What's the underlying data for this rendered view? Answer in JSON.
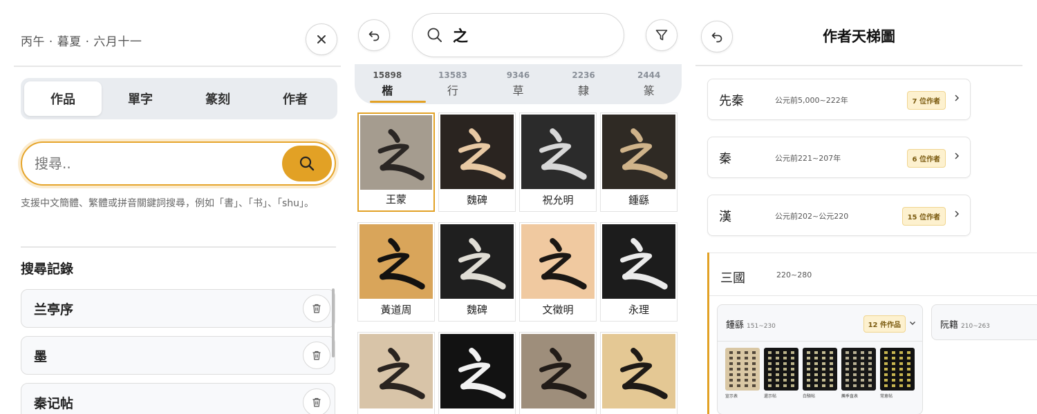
{
  "home": {
    "date": "丙午 · 暮夏 · 六月十一",
    "tabs": [
      "作品",
      "單字",
      "篆刻",
      "作者"
    ],
    "active_tab": 0,
    "search_placeholder": "搜尋..",
    "hint": "支援中文簡體、繁體或拼音關鍵詞搜尋，例如「書」、「书」、「shu」。",
    "history_title": "搜尋記錄",
    "history": [
      "兰亭序",
      "墨",
      "秦记帖"
    ]
  },
  "results": {
    "query": "之",
    "scripts": [
      {
        "count": "15898",
        "name": "楷"
      },
      {
        "count": "13583",
        "name": "行"
      },
      {
        "count": "9346",
        "name": "草"
      },
      {
        "count": "2236",
        "name": "隸"
      },
      {
        "count": "2444",
        "name": "篆"
      }
    ],
    "active_script": 0,
    "items": [
      {
        "label": "王蒙",
        "bg": "#a59c8f",
        "ink": "#2a2624"
      },
      {
        "label": "魏碑",
        "bg": "#2a2420",
        "ink": "#e8c9a4"
      },
      {
        "label": "祝允明",
        "bg": "#2b2b2b",
        "ink": "#d8d8d8"
      },
      {
        "label": "鍾繇",
        "bg": "#2f2a24",
        "ink": "#cfb38a"
      },
      {
        "label": "黃道周",
        "bg": "#d9a55a",
        "ink": "#141210"
      },
      {
        "label": "魏碑",
        "bg": "#1f1f1f",
        "ink": "#e0ddd5"
      },
      {
        "label": "文徵明",
        "bg": "#f0c9a0",
        "ink": "#1b1714"
      },
      {
        "label": "永理",
        "bg": "#1c1c1c",
        "ink": "#ebebeb"
      },
      {
        "label": "",
        "bg": "#d8c4a8",
        "ink": "#2a2420"
      },
      {
        "label": "",
        "bg": "#121212",
        "ink": "#f2f2f2"
      },
      {
        "label": "",
        "bg": "#9e8e7b",
        "ink": "#221c18"
      },
      {
        "label": "",
        "bg": "#e4c894",
        "ink": "#1e1a16"
      }
    ]
  },
  "ladder": {
    "title": "作者天梯圖",
    "eras": [
      {
        "name": "先秦",
        "range": "公元前5,000~222年",
        "badge": "7 位作者"
      },
      {
        "name": "秦",
        "range": "公元前221~207年",
        "badge": "6 位作者"
      },
      {
        "name": "漢",
        "range": "公元前202~公元220",
        "badge": "15 位作者"
      }
    ],
    "open_era": {
      "name": "三國",
      "range": "220~280",
      "authors": [
        {
          "name": "鍾繇",
          "range": "151~230",
          "badge": "12 件作品",
          "works": [
            {
              "label": "宣示表",
              "bg": "#d9c7a4",
              "ink": "#3a3028"
            },
            {
              "label": "還示帖",
              "bg": "#141414",
              "ink": "#d8cf9e"
            },
            {
              "label": "白騎帖",
              "bg": "#161616",
              "ink": "#e3d9a8"
            },
            {
              "label": "薦季直表",
              "bg": "#181818",
              "ink": "#d6ccaa"
            },
            {
              "label": "常恵帖",
              "bg": "#121212",
              "ink": "#e8d25a"
            }
          ]
        },
        {
          "name": "阮籍",
          "range": "210~263"
        }
      ]
    }
  },
  "colors": {
    "accent": "#e2a125",
    "segment_bg": "#e9ecf0",
    "badge_bg": "#fdf1cf"
  }
}
